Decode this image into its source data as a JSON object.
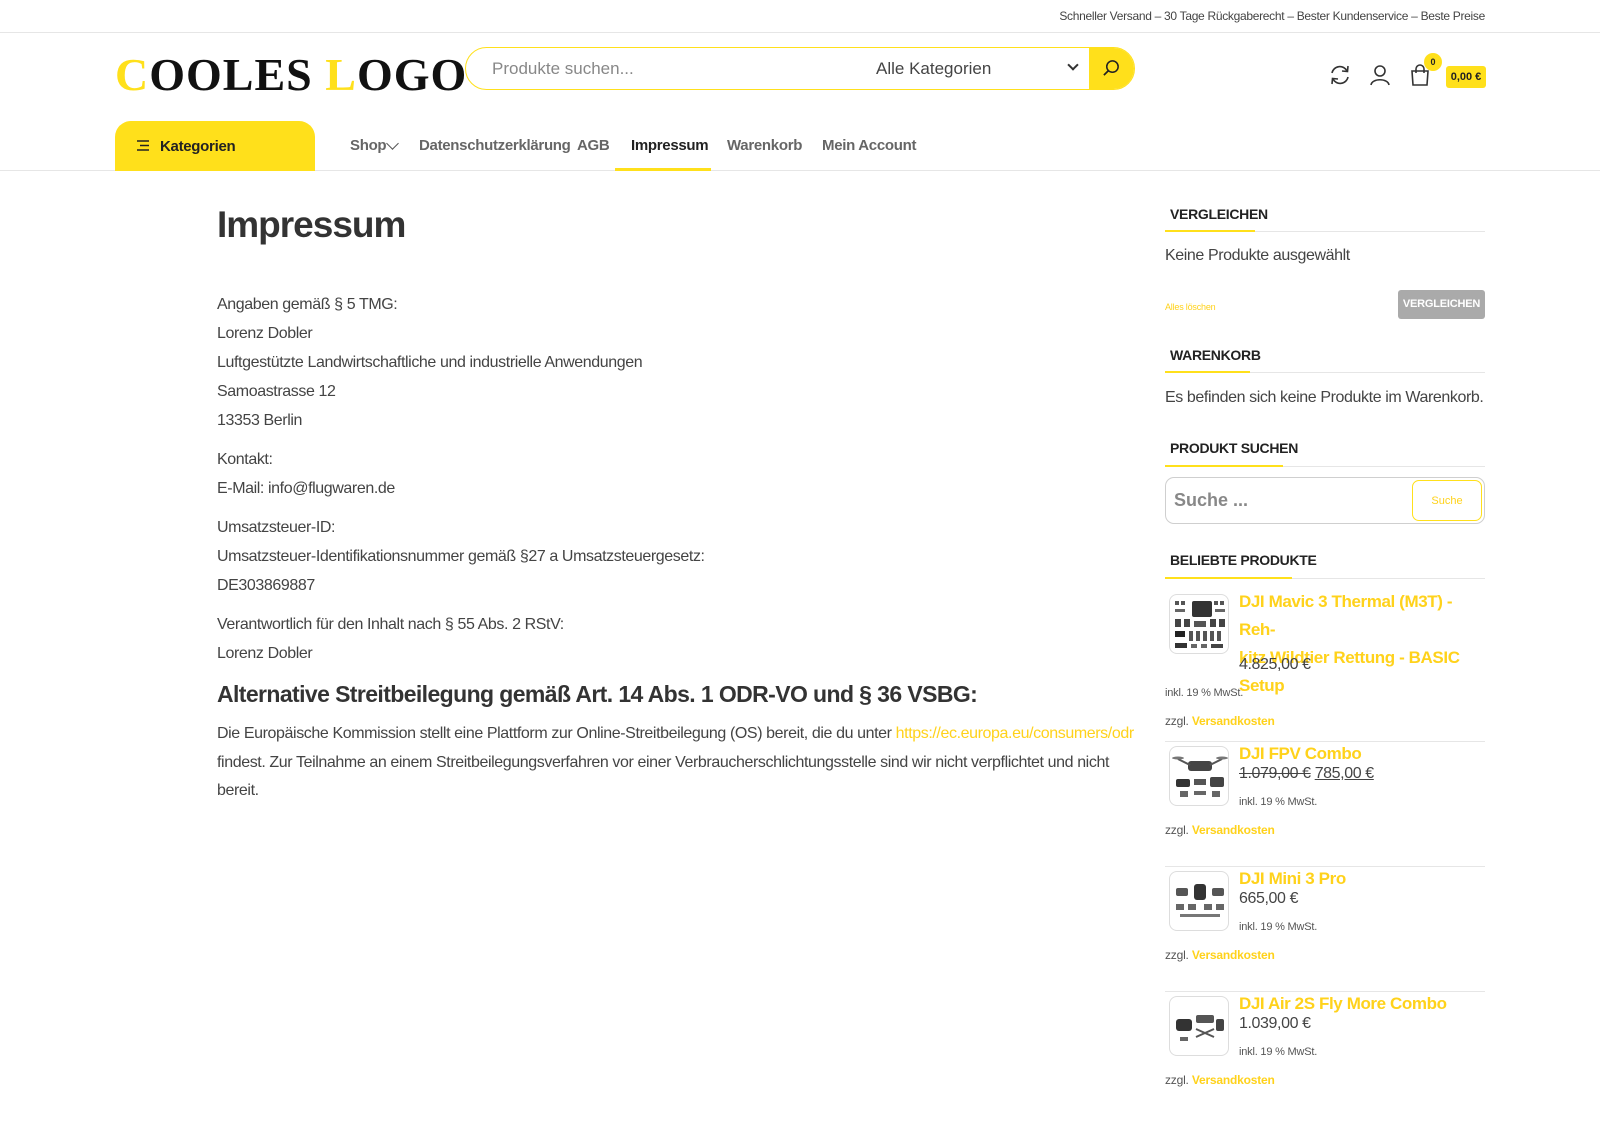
{
  "topbar": {
    "text": "Schneller Versand – 30 Tage Rückgaberecht – Bester Kundenservice – Beste Preise"
  },
  "logo": {
    "c": "C",
    "part1": "OOLES ",
    "l": "L",
    "part2": "OGO"
  },
  "search": {
    "placeholder": "Produkte suchen...",
    "category": "Alle Kategorien"
  },
  "header": {
    "cart_count": "0",
    "cart_total": "0,00 €"
  },
  "nav": {
    "categories": "Kategorien",
    "items": [
      "Shop",
      "Datenschutzerklärung",
      "AGB",
      "Impressum",
      "Warenkorb",
      "Mein Account"
    ]
  },
  "page": {
    "title": "Impressum",
    "lines": [
      "Angaben gemäß § 5 TMG:",
      "Lorenz Dobler",
      "Luftgestützte Landwirtschaftliche und industrielle Anwendungen",
      "Samoastrasse 12",
      "13353 Berlin",
      "Kontakt:",
      "E-Mail: info@flugwaren.de",
      "Umsatzsteuer-ID:",
      "Umsatzsteuer-Identifikationsnummer gemäß §27 a Umsatzsteuergesetz:",
      "DE303869887",
      "Verantwortlich für den Inhalt nach § 55 Abs. 2 RStV:",
      "Lorenz Dobler"
    ],
    "h2": "Alternative Streitbeilegung gemäß Art. 14 Abs. 1 ODR-VO und § 36 VSBG:",
    "para_before_link": "Die Europäische Kommission stellt eine Plattform zur Online-Streitbeilegung (OS) bereit, die du unter ",
    "para_link": "https://ec.europa.eu/consumers/odr",
    "para_line2": "findest. Zur Teilnahme an einem Streitbeilegungsverfahren vor einer Verbraucherschlichtungsstelle sind wir nicht verpflichtet und nicht",
    "para_line3": "bereit."
  },
  "sidebar": {
    "compare": {
      "title": "VERGLEICHEN",
      "empty": "Keine Produkte ausgewählt",
      "clear": "Alles löschen",
      "button": "VERGLEICHEN"
    },
    "cart": {
      "title": "WARENKORB",
      "empty": "Es befinden sich keine Produkte im Warenkorb."
    },
    "search": {
      "title": "PRODUKT SUCHEN",
      "placeholder": "Suche ...",
      "button": "Suche"
    },
    "popular": {
      "title": "BELIEBTE PRODUKTE",
      "tax": "inkl. 19 % MwSt.",
      "ship_prefix": "zzgl.",
      "ship_link": "Versandkosten",
      "products": [
        {
          "name_line1": "DJI Mavic 3 Thermal (M3T) - Reh-",
          "name_line2": "kitz Wildtier Rettung - BASIC Setup",
          "price": "4.825,00 €",
          "old_price": "",
          "new_price": ""
        },
        {
          "name_line1": "DJI FPV Combo",
          "name_line2": "",
          "price": "",
          "old_price": "1.079,00 €",
          "new_price": "785,00 €"
        },
        {
          "name_line1": "DJI Mini 3 Pro",
          "name_line2": "",
          "price": "665,00 €",
          "old_price": "",
          "new_price": ""
        },
        {
          "name_line1": "DJI Air 2S Fly More Combo",
          "name_line2": "",
          "price": "1.039,00 €",
          "old_price": "",
          "new_price": ""
        }
      ]
    }
  }
}
